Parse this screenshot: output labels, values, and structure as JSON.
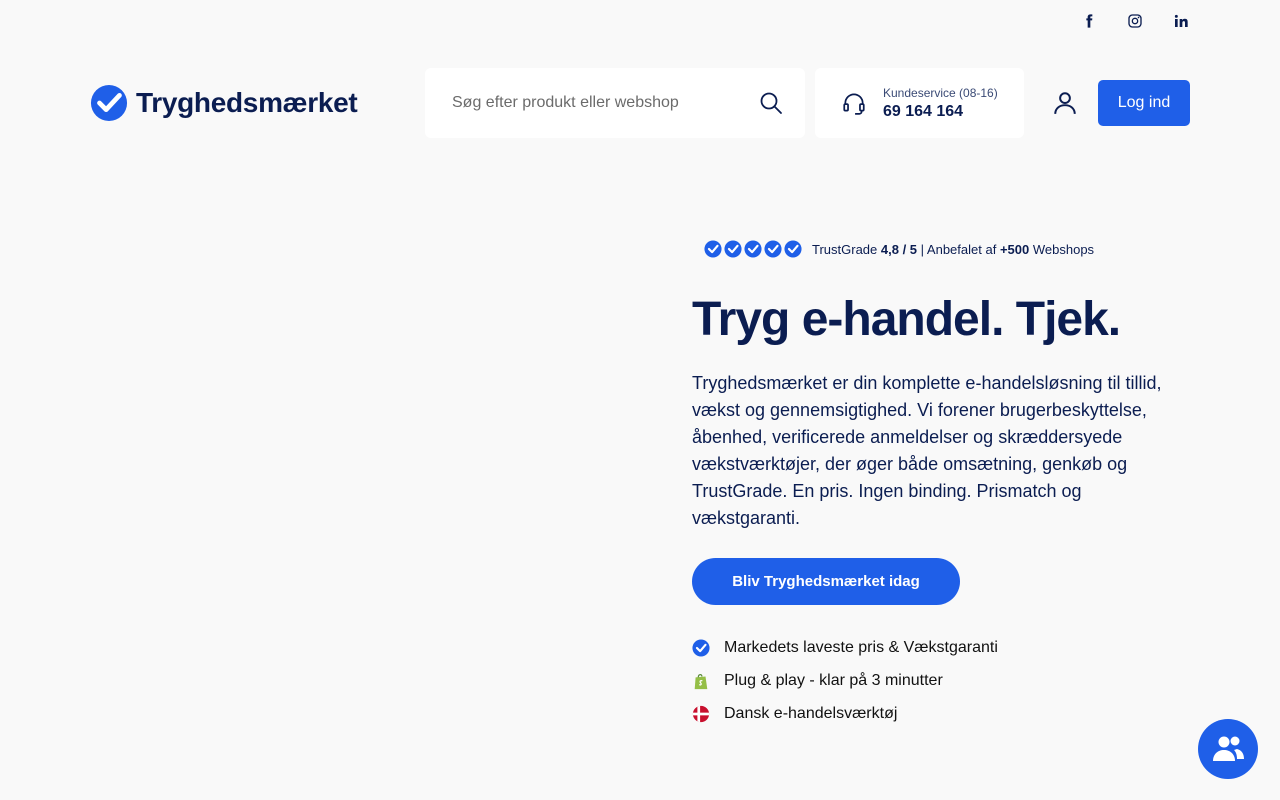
{
  "social": {
    "icons": [
      "facebook-icon",
      "instagram-icon",
      "linkedin-icon"
    ]
  },
  "header": {
    "logo_text": "Tryghedsmærket",
    "search_placeholder": "Søg efter produkt eller webshop",
    "support_label": "Kundeservice (08-16)",
    "support_phone": "69 164 164",
    "login_label": "Log ind"
  },
  "hero": {
    "rating_prefix": "TrustGrade",
    "rating_score": "4,8 / 5",
    "rating_mid": "| Anbefalet af",
    "rating_count": "+500",
    "rating_suffix": "Webshops",
    "title": "Tryg e-handel. Tjek.",
    "description": "Tryghedsmærket er din komplette e-handelsløsning til tillid, vækst og gennemsigtighed. Vi forener brugerbeskyttelse, åbenhed, verificerede anmeldelser og skræddersyede vækstværktøjer, der øger både omsætning, genkøb og TrustGrade. En pris. Ingen binding. Prismatch og vækstgaranti.",
    "cta_label": "Bliv Tryghedsmærket idag",
    "features": [
      {
        "icon": "check-badge-icon",
        "text": "Markedets laveste pris & Vækstgaranti"
      },
      {
        "icon": "shopify-icon",
        "text": "Plug & play - klar på 3 minutter"
      },
      {
        "icon": "danish-flag-icon",
        "text": "Dansk e-handelsværktøj"
      }
    ]
  },
  "colors": {
    "brand_blue": "#1f5fe8",
    "navy": "#0b1d51",
    "background": "#f9f9f9"
  }
}
